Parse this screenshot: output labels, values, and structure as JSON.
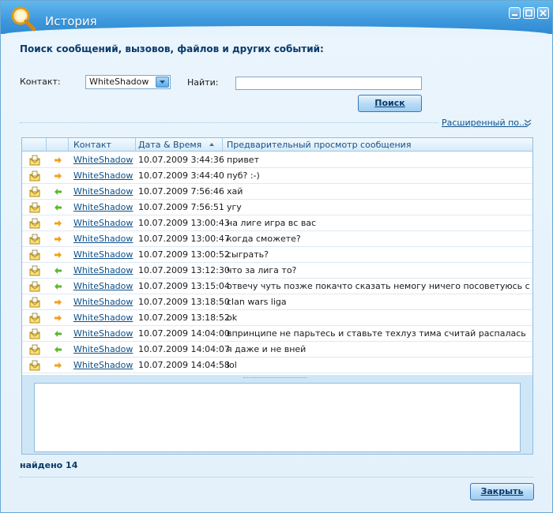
{
  "window": {
    "title": "История"
  },
  "heading": "Поиск сообщений, вызовов, файлов и других событий:",
  "filters": {
    "contact_label": "Контакт:",
    "contact_value": "WhiteShadow",
    "find_label": "Найти:",
    "find_value": "",
    "search_button": "Поиск",
    "advanced_link": "Расширенный по..."
  },
  "table": {
    "columns": {
      "contact": "Контакт",
      "datetime": "Дата & Время",
      "preview": "Предварительный просмотр сообщения"
    },
    "rows": [
      {
        "dir": "out",
        "contact": "WhiteShadow",
        "date": "10.07.2009 3:44:36",
        "msg": "привет"
      },
      {
        "dir": "out",
        "contact": "WhiteShadow",
        "date": "10.07.2009 3:44:40",
        "msg": "пуб? :-)"
      },
      {
        "dir": "in",
        "contact": "WhiteShadow",
        "date": "10.07.2009 7:56:46",
        "msg": "хай"
      },
      {
        "dir": "in",
        "contact": "WhiteShadow",
        "date": "10.07.2009 7:56:51",
        "msg": "угу"
      },
      {
        "dir": "out",
        "contact": "WhiteShadow",
        "date": "10.07.2009 13:00:43",
        "msg": "на лиге игра вс вас"
      },
      {
        "dir": "out",
        "contact": "WhiteShadow",
        "date": "10.07.2009 13:00:47",
        "msg": "когда сможете?"
      },
      {
        "dir": "out",
        "contact": "WhiteShadow",
        "date": "10.07.2009 13:00:52",
        "msg": "сыграть?"
      },
      {
        "dir": "in",
        "contact": "WhiteShadow",
        "date": "10.07.2009 13:12:30",
        "msg": "что за лига то?"
      },
      {
        "dir": "in",
        "contact": "WhiteShadow",
        "date": "10.07.2009 13:15:04",
        "msg": "отвечу чуть позже покачто сказать немогу ничего посоветуюсь с мейтами"
      },
      {
        "dir": "out",
        "contact": "WhiteShadow",
        "date": "10.07.2009 13:18:50",
        "msg": "clan wars liga"
      },
      {
        "dir": "out",
        "contact": "WhiteShadow",
        "date": "10.07.2009 13:18:52",
        "msg": "ok"
      },
      {
        "dir": "in",
        "contact": "WhiteShadow",
        "date": "10.07.2009 14:04:00",
        "msg": "впринципе не парьтесь и ставьте техлуз тима считай распалась"
      },
      {
        "dir": "in",
        "contact": "WhiteShadow",
        "date": "10.07.2009 14:04:07",
        "msg": "я даже и не вней"
      },
      {
        "dir": "out",
        "contact": "WhiteShadow",
        "date": "10.07.2009 14:04:58",
        "msg": "lol"
      }
    ]
  },
  "status": {
    "found": "найдено 14"
  },
  "footer": {
    "close_button": "Закрыть"
  },
  "colors": {
    "out_arrow": "#f0a020",
    "in_arrow": "#5cb82e",
    "link": "#0b4f8a",
    "heading": "#0b3a6a"
  },
  "icons": {
    "row_type": "message-envelope-icon",
    "out": "arrow-right-icon",
    "in": "arrow-left-icon"
  }
}
